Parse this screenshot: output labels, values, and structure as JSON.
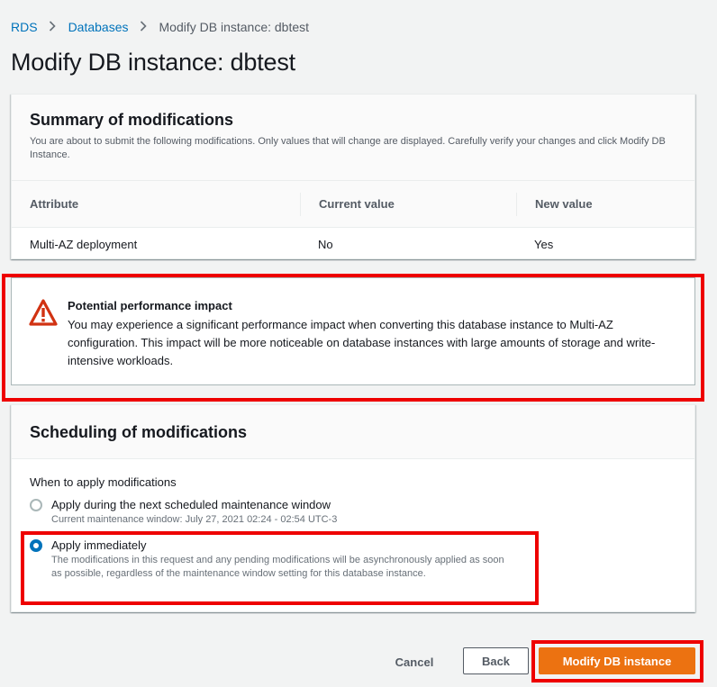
{
  "breadcrumb": {
    "items": [
      "RDS",
      "Databases"
    ],
    "current": "Modify DB instance: dbtest"
  },
  "page_title": "Modify DB instance: dbtest",
  "summary": {
    "title": "Summary of modifications",
    "description": "You are about to submit the following modifications. Only values that will change are displayed. Carefully verify your changes and click Modify DB Instance.",
    "columns": [
      "Attribute",
      "Current value",
      "New value"
    ],
    "rows": [
      [
        "Multi-AZ deployment",
        "No",
        "Yes"
      ]
    ]
  },
  "alert": {
    "icon": "warning-icon",
    "title": "Potential performance impact",
    "body": "You may experience a significant performance impact when converting this database instance to Multi-AZ configuration. This impact will be more noticeable on database instances with large amounts of storage and write-intensive workloads."
  },
  "scheduling": {
    "title": "Scheduling of modifications",
    "when_label": "When to apply modifications",
    "options": [
      {
        "label": "Apply during the next scheduled maintenance window",
        "description": "Current maintenance window: July 27, 2021 02:24 - 02:54 UTC-3",
        "selected": false
      },
      {
        "label": "Apply immediately",
        "description": "The modifications in this request and any pending modifications will be asynchronously applied as soon as possible, regardless of the maintenance window setting for this database instance.",
        "selected": true
      }
    ]
  },
  "actions": {
    "cancel": "Cancel",
    "back": "Back",
    "submit": "Modify DB instance"
  },
  "colors": {
    "link": "#0073bb",
    "primary": "#ec7211",
    "warning": "#d13212",
    "highlight": "#ee0000"
  }
}
